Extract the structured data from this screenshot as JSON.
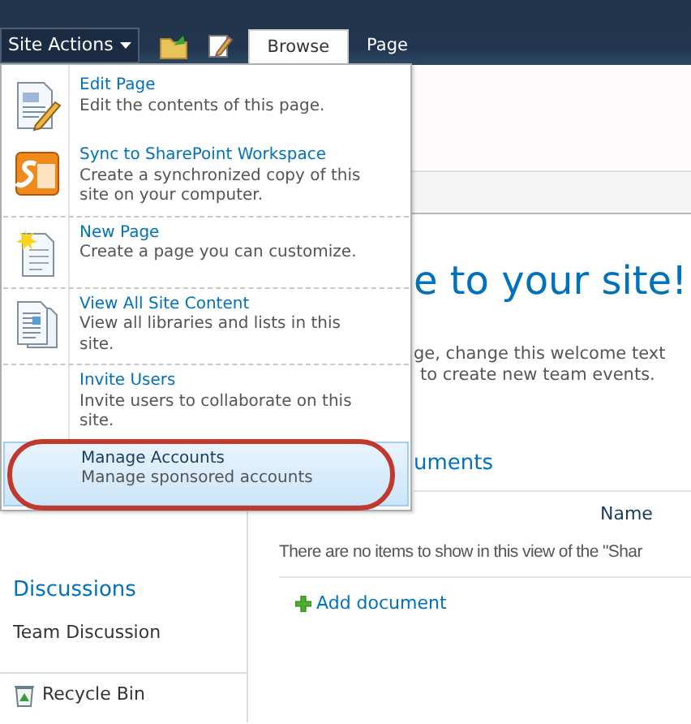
{
  "ribbon": {
    "site_actions": "Site Actions",
    "tabs": [
      {
        "label": "Browse",
        "selected": true
      },
      {
        "label": "Page",
        "selected": false
      }
    ]
  },
  "menu": {
    "items": [
      {
        "title": "Edit Page",
        "description": "Edit the contents of this page.",
        "selected": false,
        "circled": false
      },
      {
        "title": "Sync to SharePoint Workspace",
        "description": "Create a synchronized copy of this site on your computer.",
        "selected": false,
        "circled": false
      },
      {
        "title": "New Page",
        "description": "Create a page you can customize.",
        "selected": false,
        "circled": false
      },
      {
        "title": "View All Site Content",
        "description": "View all libraries and lists in this site.",
        "selected": false,
        "circled": false
      },
      {
        "title": "Invite Users",
        "description": "Invite users to collaborate on this site.",
        "selected": false,
        "circled": false
      },
      {
        "title": "Manage Accounts",
        "description": "Manage sponsored accounts",
        "selected": true,
        "circled": true
      }
    ]
  },
  "main": {
    "heading": "e to your site!",
    "intro_lines": [
      "ge, change this welcome text",
      "to create new team events."
    ],
    "library_title": "uments",
    "column_header": "Name",
    "empty_message": "There are no items to show in this view of the \"Shar",
    "add_link": "Add document"
  },
  "quick_launch": {
    "heading": "Discussions",
    "items": [
      "Team Discussion"
    ],
    "recycle_bin": "Recycle Bin"
  }
}
